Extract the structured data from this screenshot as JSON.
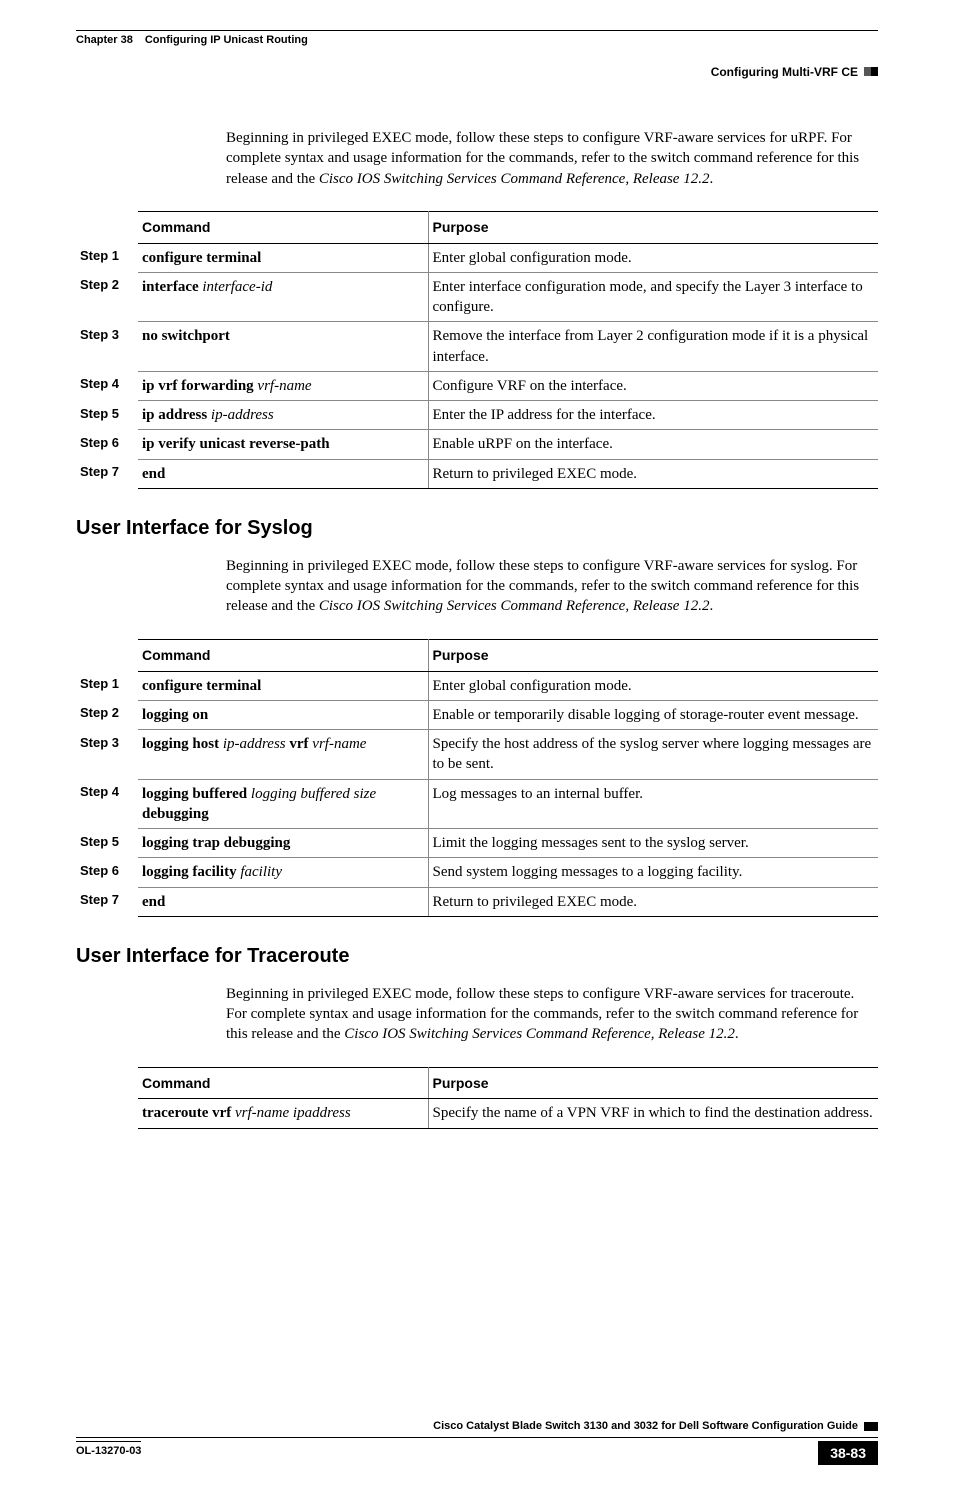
{
  "header": {
    "chapter_label": "Chapter 38",
    "chapter_title": "Configuring IP Unicast Routing",
    "section_right": "Configuring Multi-VRF CE"
  },
  "intro1_a": "Beginning in privileged EXEC mode, follow these steps to configure VRF-aware services for uRPF. For complete syntax and usage information for the commands, refer to the switch command reference for this release and the ",
  "intro1_b": "Cisco IOS Switching Services Command Reference, Release 12.2",
  "intro1_c": ".",
  "table_headers": {
    "command": "Command",
    "purpose": "Purpose"
  },
  "table1": [
    {
      "step": "Step 1",
      "cmd_b1": "configure terminal",
      "purpose": "Enter global configuration mode."
    },
    {
      "step": "Step 2",
      "cmd_b1": "interface ",
      "cmd_i1": "interface-id",
      "purpose": "Enter interface configuration mode, and specify the Layer 3 interface to configure."
    },
    {
      "step": "Step 3",
      "cmd_b1": "no switchport",
      "purpose": "Remove the interface from Layer 2 configuration mode if it is a physical interface."
    },
    {
      "step": "Step 4",
      "cmd_b1": "ip vrf forwarding ",
      "cmd_i1": "vrf-name",
      "purpose": "Configure VRF on the interface."
    },
    {
      "step": "Step 5",
      "cmd_b1": "ip address ",
      "cmd_i1": "ip-address",
      "purpose": "Enter the IP address for the interface."
    },
    {
      "step": "Step 6",
      "cmd_b1": "ip verify unicast reverse-path",
      "purpose": "Enable uRPF on the interface."
    },
    {
      "step": "Step 7",
      "cmd_b1": "end",
      "purpose": "Return to privileged EXEC mode."
    }
  ],
  "h2_syslog": "User Interface for Syslog",
  "intro2_a": "Beginning in privileged EXEC mode, follow these steps to configure VRF-aware services for syslog. For complete syntax and usage information for the commands, refer to the switch command reference for this release and the ",
  "intro2_b": "Cisco IOS Switching Services Command Reference, Release 12.2",
  "intro2_c": ".",
  "table2": [
    {
      "step": "Step 1",
      "cmd_b1": "configure terminal",
      "purpose": "Enter global configuration mode."
    },
    {
      "step": "Step 2",
      "cmd_b1": "logging on",
      "purpose": "Enable or temporarily disable logging of storage-router event message."
    },
    {
      "step": "Step 3",
      "cmd_b1": "logging host ",
      "cmd_i1": "ip-address ",
      "cmd_b2": "vrf ",
      "cmd_i2": "vrf-name",
      "purpose": "Specify the host address of the syslog server where logging messages are to be sent."
    },
    {
      "step": "Step 4",
      "cmd_b1": "logging buffered ",
      "cmd_i1": "logging buffered size ",
      "cmd_b2": "debugging",
      "purpose": "Log messages to an internal buffer."
    },
    {
      "step": "Step 5",
      "cmd_b1": "logging trap debugging",
      "purpose": "Limit the logging messages sent to the syslog server."
    },
    {
      "step": "Step 6",
      "cmd_b1": "logging facility ",
      "cmd_i1": "facility",
      "purpose": "Send system logging messages to a logging facility."
    },
    {
      "step": "Step 7",
      "cmd_b1": "end",
      "purpose": "Return to privileged EXEC mode."
    }
  ],
  "h2_traceroute": "User Interface for Traceroute",
  "intro3_a": "Beginning in privileged EXEC mode, follow these steps to configure VRF-aware services for traceroute. For complete syntax and usage information for the commands, refer to the switch command reference for this release and the ",
  "intro3_b": "Cisco IOS Switching Services Command Reference, Release 12.2",
  "intro3_c": ".",
  "table3": {
    "cmd_b1": "traceroute vrf ",
    "cmd_i1": "vrf-name ipaddress",
    "purpose": "Specify the name of a VPN VRF in which to find the destination address."
  },
  "footer": {
    "book": "Cisco Catalyst Blade Switch 3130 and 3032 for Dell Software Configuration Guide",
    "doc_id": "OL-13270-03",
    "page": "38-83"
  }
}
